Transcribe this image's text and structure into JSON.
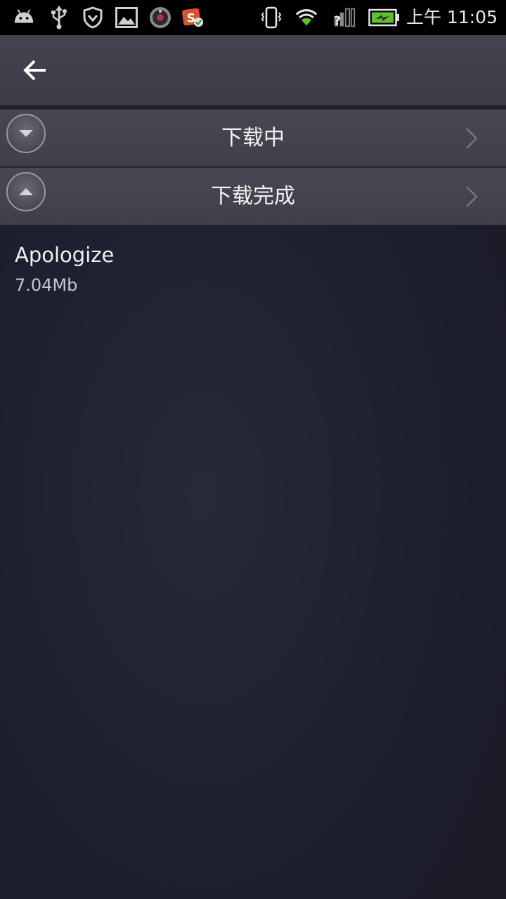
{
  "status_bar": {
    "time": "上午 11:05",
    "icons": [
      "android-debug-icon",
      "usb-icon",
      "shield-icon",
      "gallery-icon",
      "camera-app-icon",
      "app-badge-icon",
      "vibrate-icon",
      "wifi-icon",
      "signal-unknown-icon",
      "battery-charging-icon"
    ]
  },
  "action_bar": {
    "back_icon": "arrow-left-icon"
  },
  "categories": [
    {
      "label": "下载中",
      "toggle_icon": "chevron-down-circle-icon",
      "nav_icon": "chevron-right-icon"
    },
    {
      "label": "下载完成",
      "toggle_icon": "chevron-up-circle-icon",
      "nav_icon": "chevron-right-icon"
    }
  ],
  "downloads": [
    {
      "title": "Apologize",
      "size": "7.04Mb"
    }
  ],
  "colors": {
    "status_bar_bg": "#000000",
    "action_bar_bg": "#413f4b",
    "row_bg": "#45434f",
    "page_bg": "#1e2030",
    "text_primary": "#f0f0f0",
    "text_secondary": "#c8c8cc"
  }
}
